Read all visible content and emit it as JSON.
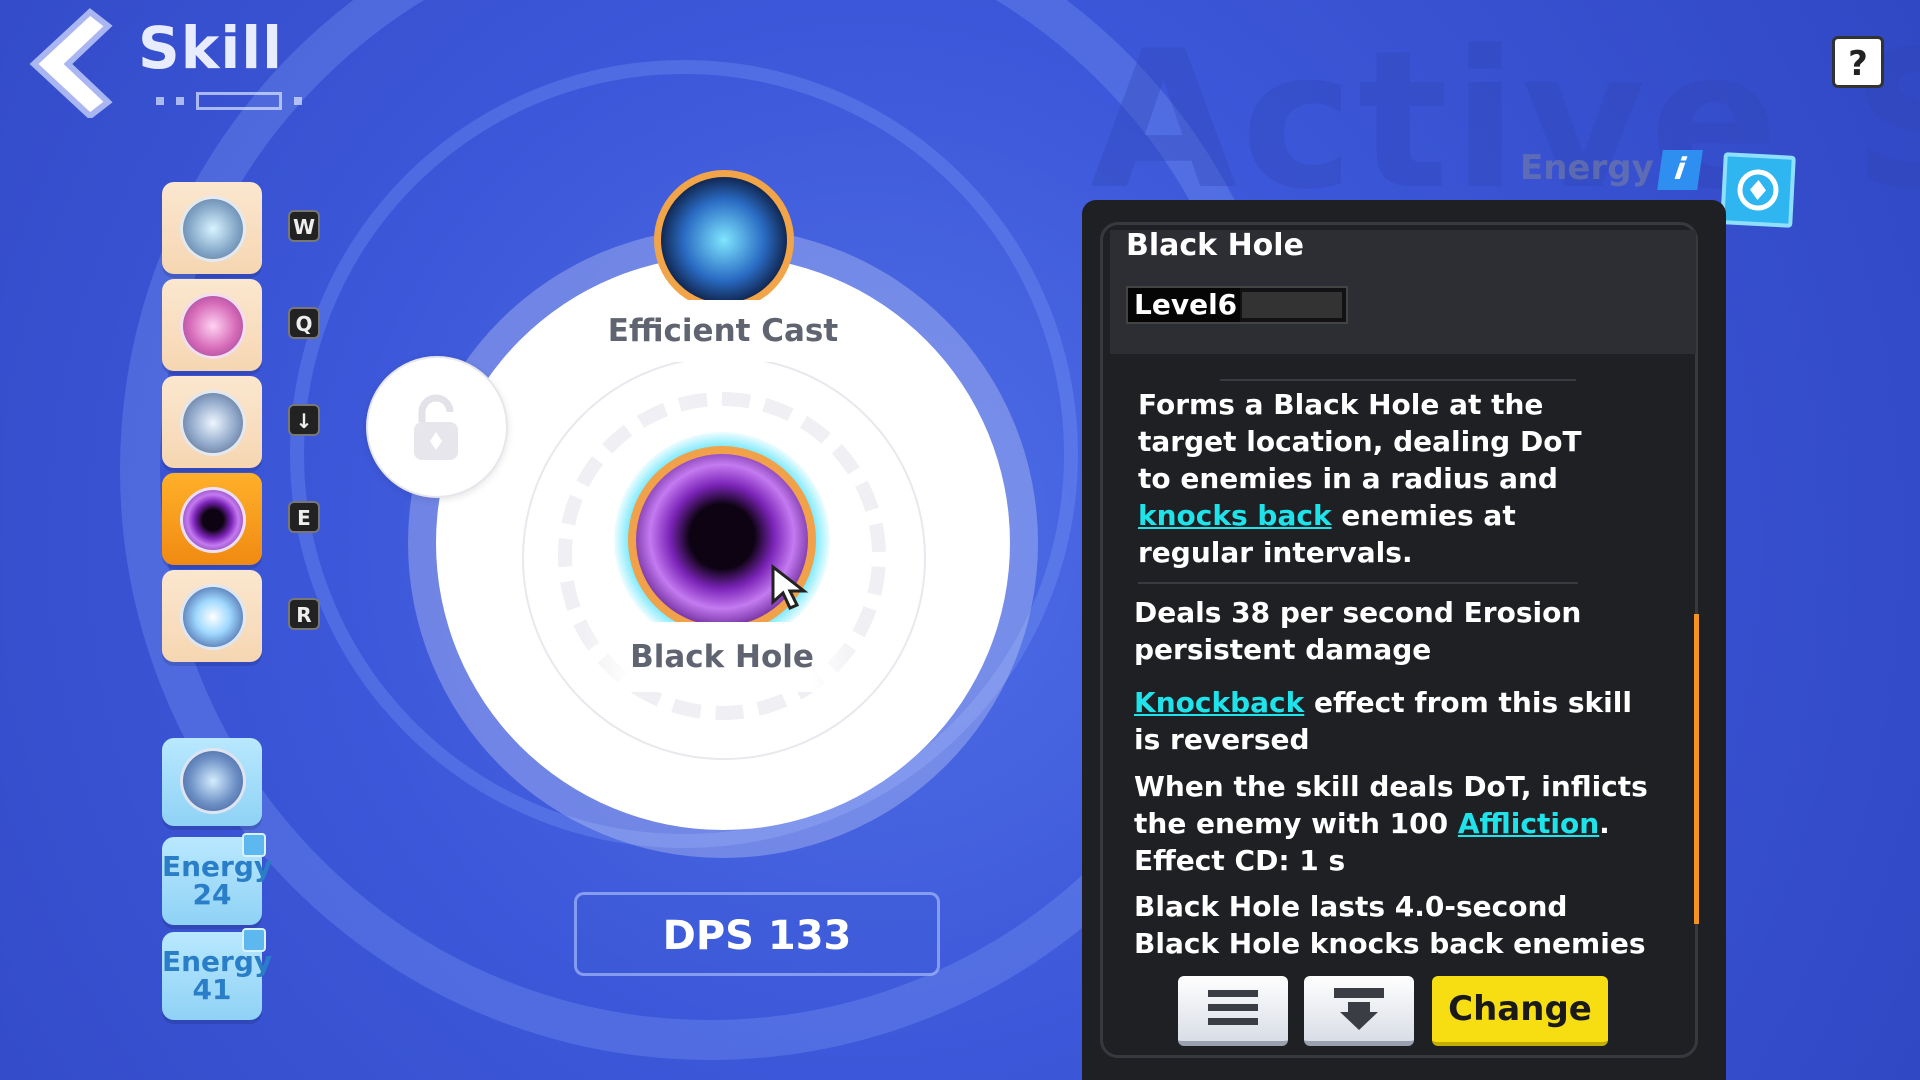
{
  "header": {
    "title": "Skill",
    "background_word": "Active Sk"
  },
  "help": {
    "label": "?"
  },
  "energy_area": {
    "label": "Energy",
    "info_label": "i"
  },
  "skill_slots": [
    {
      "icon": "wind-slash-icon",
      "key": "W"
    },
    {
      "icon": "potion-icon",
      "key": "Q"
    },
    {
      "icon": "dash-icon",
      "key": "↓"
    },
    {
      "icon": "black-hole-icon",
      "key": "E",
      "active": true
    },
    {
      "icon": "ice-burst-icon",
      "key": "R"
    }
  ],
  "support_slots": [
    {
      "icon": "spirit-icon"
    },
    {
      "label": "Energy",
      "value": "24"
    },
    {
      "label": "Energy",
      "value": "41"
    }
  ],
  "wheel": {
    "top_skill": {
      "icon": "efficient-cast-icon",
      "label": "Efficient Cast"
    },
    "center_skill": {
      "icon": "black-hole-icon",
      "label": "Black Hole"
    },
    "locked_slot_icon": "lock-icon"
  },
  "dps": {
    "label": "DPS 133"
  },
  "panel": {
    "title": "Black Hole",
    "level": "Level6",
    "level_progress": 0,
    "description": {
      "line1": "Forms a Black Hole at the",
      "line2": "target location, dealing DoT",
      "line3": "to enemies in a radius and",
      "link": "knocks back",
      "line4_rest": " enemies at",
      "line5": "regular intervals."
    },
    "effects": [
      {
        "text": "Deals 38 per second Erosion",
        "text2": "persistent damage"
      },
      {
        "link": "Knockback",
        "text": " effect from this skill",
        "text2": "is reversed"
      },
      {
        "text": "When the skill deals DoT, inflicts",
        "pre": "the enemy with 100 ",
        "link": "Affliction",
        "post": ".",
        "text3": "Effect CD: 1 s"
      },
      {
        "text": "Black Hole lasts 4.0-second",
        "text2": "Black Hole knocks back enemies"
      }
    ],
    "buttons": {
      "menu_icon": "menu-icon",
      "down_icon": "download-icon",
      "change": "Change"
    }
  },
  "colors": {
    "accent": "#f6de12",
    "link": "#1ee3ea",
    "active_slot": "#f08a12",
    "background": "#3c57d9"
  }
}
